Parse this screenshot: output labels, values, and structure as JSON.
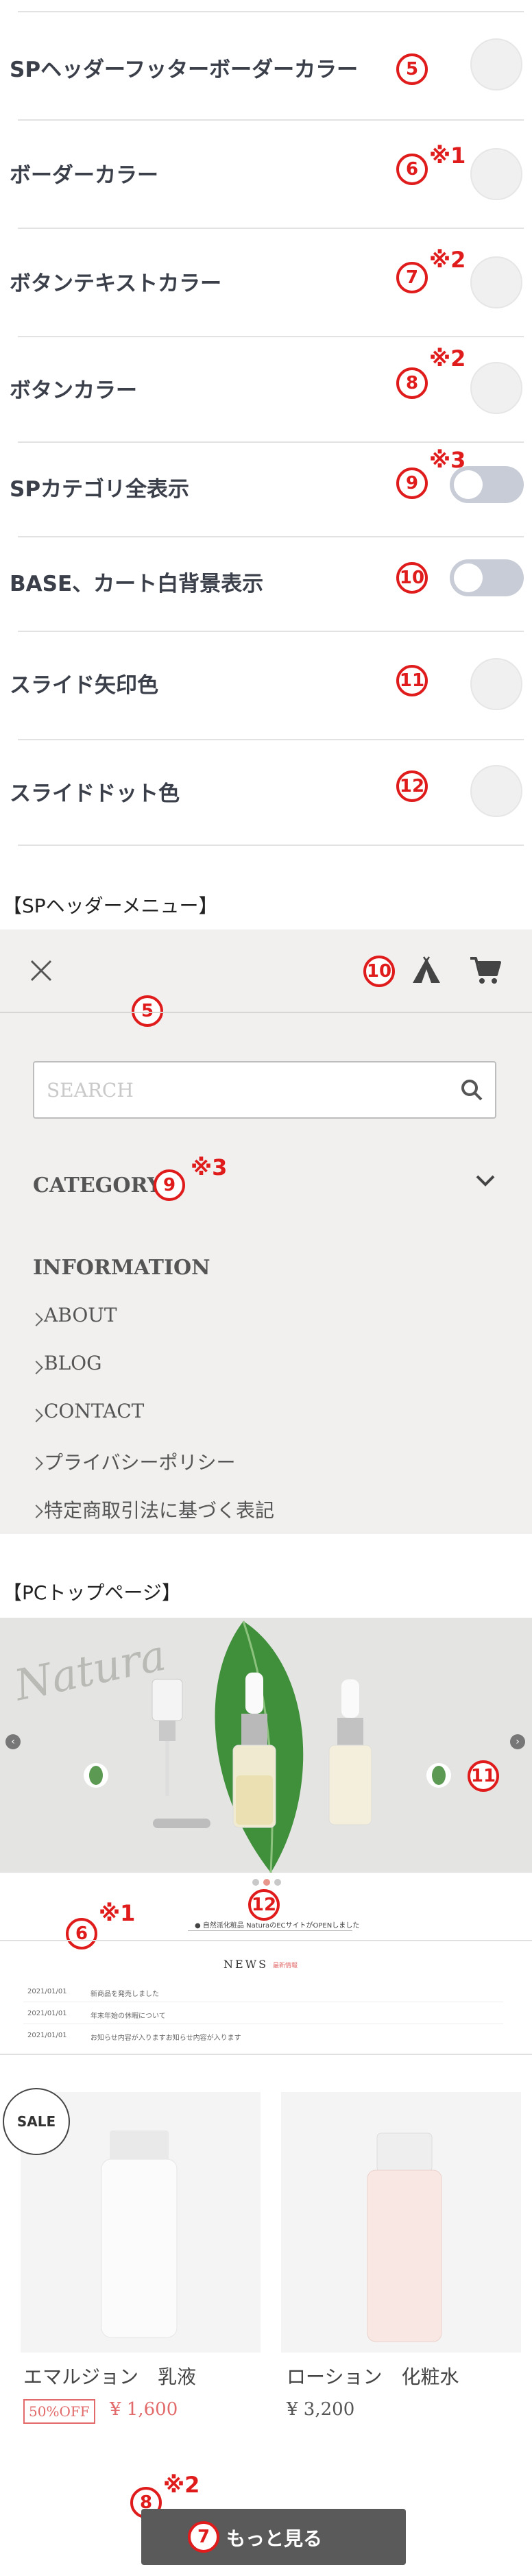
{
  "settings": {
    "rows": [
      {
        "label": "SPヘッダーフッターボーダーカラー",
        "badge": "5",
        "note": "",
        "control": "swatch"
      },
      {
        "label": "ボーダーカラー",
        "badge": "6",
        "note": "※1",
        "control": "swatch"
      },
      {
        "label": "ボタンテキストカラー",
        "badge": "7",
        "note": "※2",
        "control": "swatch"
      },
      {
        "label": "ボタンカラー",
        "badge": "8",
        "note": "※2",
        "control": "swatch"
      },
      {
        "label": "SPカテゴリ全表示",
        "badge": "9",
        "note": "※3",
        "control": "toggle"
      },
      {
        "label": "BASE、カート白背景表示",
        "badge": "10",
        "note": "",
        "control": "toggle"
      },
      {
        "label": "スライド矢印色",
        "badge": "11",
        "note": "",
        "control": "swatch"
      },
      {
        "label": "スライドドット色",
        "badge": "12",
        "note": "",
        "control": "swatch"
      }
    ]
  },
  "sp_header": {
    "section_title": "【SPヘッダーメニュー】",
    "badge_header": "5",
    "badge_icons": "10",
    "search_placeholder": "SEARCH",
    "category_label": "CATEGORY",
    "category_badge": "9",
    "category_note": "※3",
    "information_label": "INFORMATION",
    "links": [
      "ABOUT",
      "BLOG",
      "CONTACT",
      "プライバシーポリシー",
      "特定商取引法に基づく表記"
    ],
    "icons": {
      "close": "close-icon",
      "tent": "tent-icon",
      "cart": "cart-icon",
      "search": "search-icon",
      "chevron": "chevron-down-icon"
    }
  },
  "pc_top": {
    "section_title": "【PCトップページ】",
    "slide_script": "Natura",
    "badge_arrow": "11",
    "badge_dots": "12",
    "badge_border": "6",
    "border_note": "※1",
    "ticker": "● 自然派化粧品 NaturaのECサイトがOPENしました",
    "news": {
      "title": "NEWS",
      "subtitle": "最新情報",
      "items": [
        {
          "date": "2021/01/01",
          "text": "新商品を発売しました"
        },
        {
          "date": "2021/01/01",
          "text": "年末年始の休暇について"
        },
        {
          "date": "2021/01/01",
          "text": "お知らせ内容が入りますお知らせ内容が入ります"
        }
      ]
    },
    "products": [
      {
        "name": "エマルジョン　乳液",
        "sale_badge": "SALE",
        "discount": "50%OFF",
        "price": "¥ 1,600"
      },
      {
        "name": "ローション　化粧水",
        "sale_badge": "",
        "discount": "",
        "price": "¥ 3,200"
      }
    ],
    "more_button": "もっと見る",
    "badge_button_text": "7",
    "badge_button": "8",
    "button_note": "※2"
  },
  "colors": {
    "accent_red": "#e01b1b",
    "menu_bg": "#f1f0ee",
    "button_bg": "#5a5a5a",
    "discount_red": "#e26a6a"
  }
}
